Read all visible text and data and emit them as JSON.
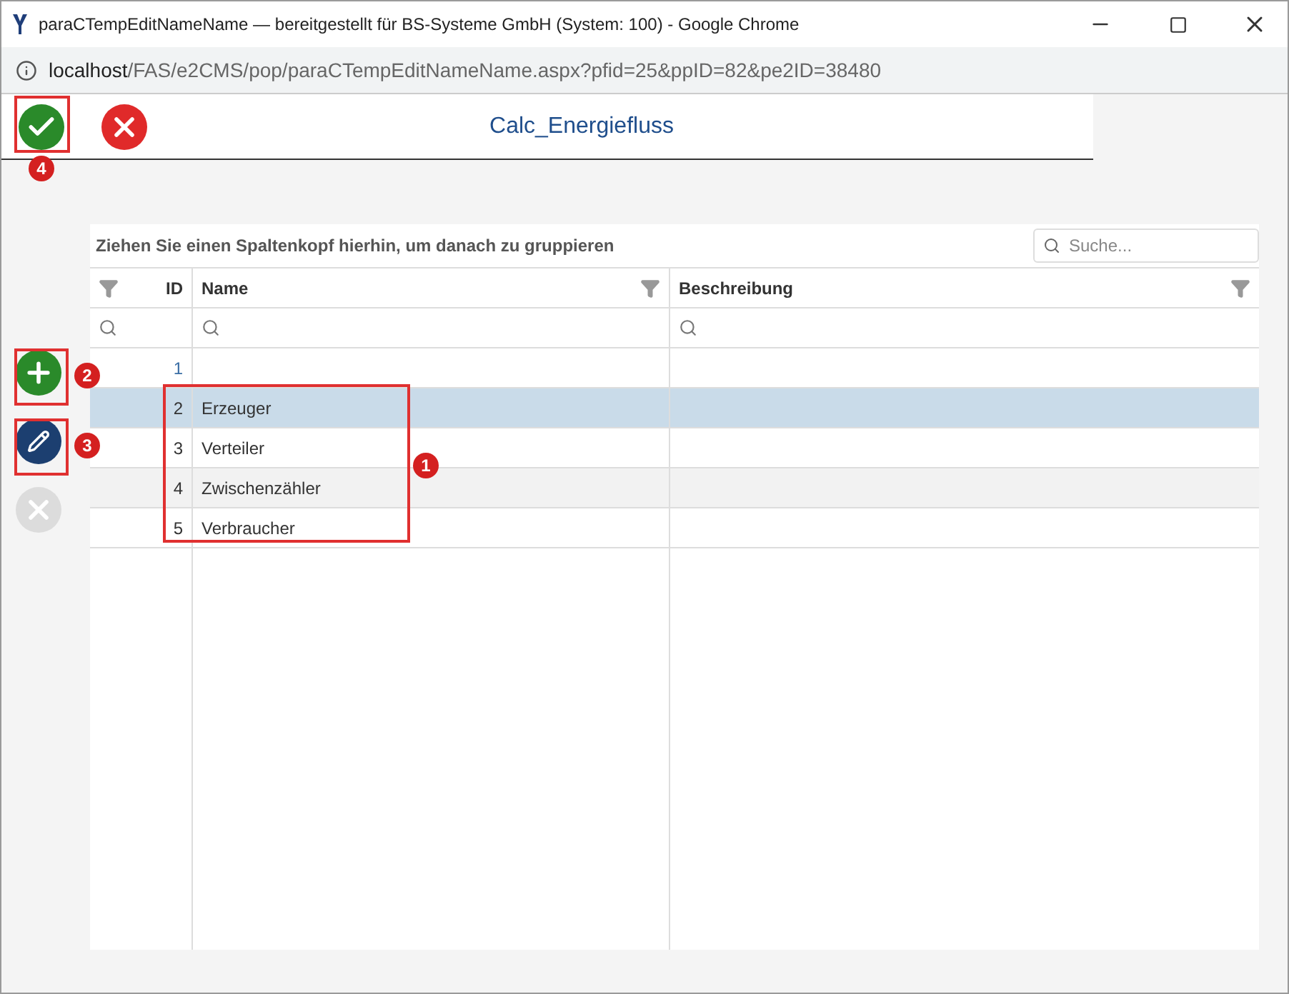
{
  "window": {
    "title": "paraCTempEditNameName — bereitgestellt für BS-Systeme GmbH (System: 100) - Google Chrome"
  },
  "address": {
    "host": "localhost",
    "path": "/FAS/e2CMS/pop/paraCTempEditNameName.aspx?pfid=25&ppID=82&pe2ID=38480"
  },
  "page_title": "Calc_Energiefluss",
  "callouts": [
    "1",
    "2",
    "3",
    "4"
  ],
  "grid": {
    "group_hint": "Ziehen Sie einen Spaltenkopf hierhin, um danach zu gruppieren",
    "search": {
      "placeholder": "Suche..."
    },
    "columns": [
      "ID",
      "Name",
      "Beschreibung"
    ],
    "rows": [
      {
        "id": "1",
        "name": "",
        "selected": false
      },
      {
        "id": "2",
        "name": "Erzeuger",
        "selected": true
      },
      {
        "id": "3",
        "name": "Verteiler",
        "selected": false
      },
      {
        "id": "4",
        "name": "Zwischenzähler",
        "selected": false
      },
      {
        "id": "5",
        "name": "Verbraucher",
        "selected": false
      }
    ]
  },
  "side_buttons": [
    {
      "kind": "add",
      "disabled": false
    },
    {
      "kind": "edit",
      "disabled": false
    },
    {
      "kind": "delete",
      "disabled": true
    }
  ]
}
